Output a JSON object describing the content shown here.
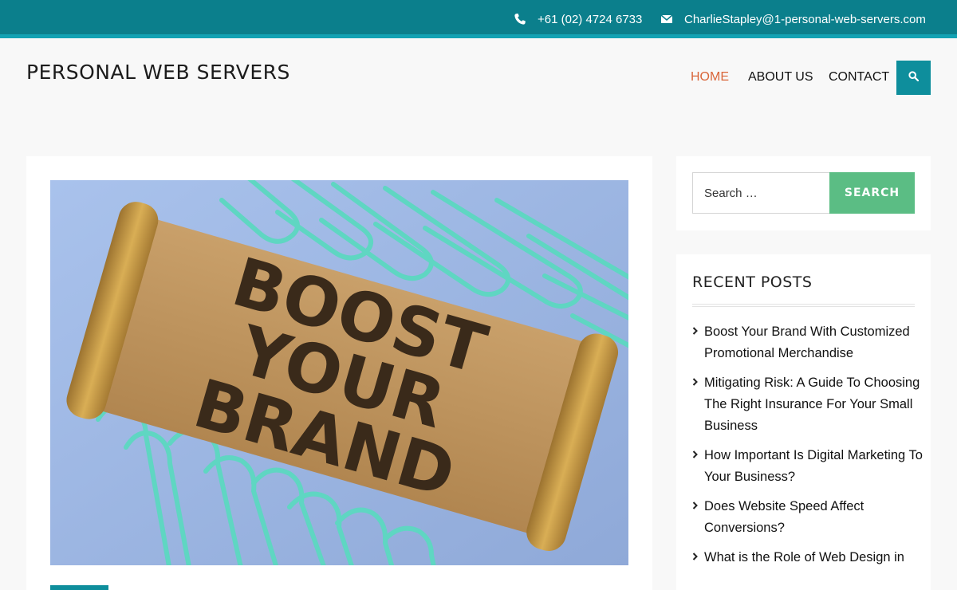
{
  "topbar": {
    "phone": "+61 (02) 4724 6733",
    "email": "CharlieStapley@1-personal-web-servers.com",
    "phone_icon": "phone-icon",
    "email_icon": "envelope-icon"
  },
  "header": {
    "site_title": "PERSONAL WEB SERVERS",
    "nav": [
      {
        "label": "HOME",
        "active": true
      },
      {
        "label": "ABOUT US",
        "active": false
      },
      {
        "label": "CONTACT",
        "active": false
      }
    ],
    "search_icon": "search-icon"
  },
  "featured_image": {
    "banner_lines": [
      "BOOST",
      "YOUR",
      "BRAND"
    ]
  },
  "sidebar": {
    "search": {
      "placeholder": "Search …",
      "button_label": "SEARCH"
    },
    "recent_posts": {
      "title": "RECENT POSTS",
      "items": [
        "Boost Your Brand With Customized Promotional Merchandise",
        "Mitigating Risk: A Guide To Choosing The Right Insurance For Your Small Business",
        "How Important Is Digital Marketing To Your Business?",
        "Does Website Speed Affect Conversions?",
        "What is the Role of Web Design in"
      ]
    }
  },
  "colors": {
    "topbar": "#0b7f8c",
    "accent": "#0e8e9c",
    "active_nav": "#d9663a",
    "search_button": "#5bbd84"
  }
}
